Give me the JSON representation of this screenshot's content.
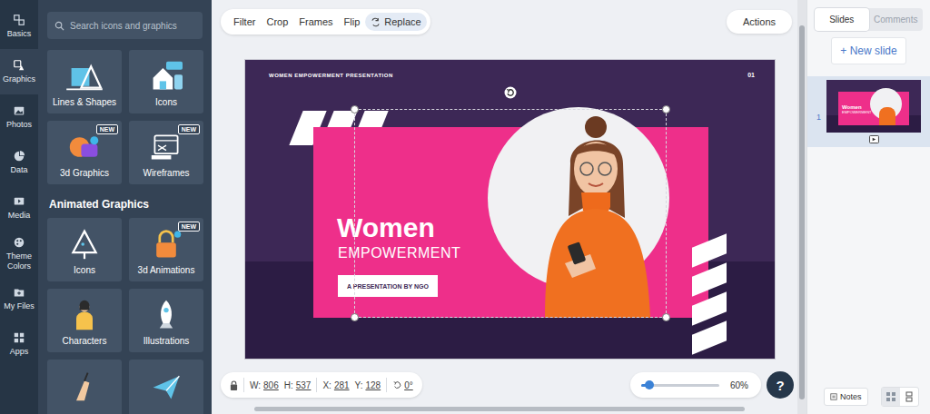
{
  "rail": [
    {
      "label": "Basics",
      "selected": false
    },
    {
      "label": "Graphics",
      "selected": true
    },
    {
      "label": "Photos",
      "selected": false
    },
    {
      "label": "Data",
      "selected": false
    },
    {
      "label": "Media",
      "selected": false
    },
    {
      "label": "Theme Colors",
      "selected": false
    },
    {
      "label": "My Files",
      "selected": false
    },
    {
      "label": "Apps",
      "selected": false
    }
  ],
  "search": {
    "placeholder": "Search icons and graphics"
  },
  "graphics": [
    {
      "label": "Lines & Shapes"
    },
    {
      "label": "Icons"
    },
    {
      "label": "3d Graphics",
      "badge": "NEW"
    },
    {
      "label": "Wireframes",
      "badge": "NEW"
    }
  ],
  "animated": {
    "heading": "Animated Graphics",
    "items": [
      {
        "label": "Icons"
      },
      {
        "label": "3d Animations",
        "badge": "NEW"
      },
      {
        "label": "Characters"
      },
      {
        "label": "Illustrations"
      },
      {
        "label": ""
      },
      {
        "label": ""
      }
    ]
  },
  "toolbar": {
    "items": [
      {
        "label": "Filter",
        "selected": false
      },
      {
        "label": "Crop",
        "selected": false
      },
      {
        "label": "Frames",
        "selected": false
      },
      {
        "label": "Flip",
        "selected": false
      },
      {
        "label": "Replace",
        "selected": true
      }
    ],
    "actions": "Actions"
  },
  "slide": {
    "header": "WOMEN EMPOWERMENT PRESENTATION",
    "number": "01",
    "title": "Women",
    "subtitle": "EMPOWERMENT",
    "tagline": "A PRESENTATION BY NGO",
    "selected": true
  },
  "status": {
    "locked": true,
    "fields": [
      {
        "label": "W:",
        "value": "806"
      },
      {
        "label": "H:",
        "value": "537"
      },
      {
        "label": "X:",
        "value": "281"
      },
      {
        "label": "Y:",
        "value": "128"
      }
    ],
    "rotation": "0°"
  },
  "zoom": {
    "level": 0.1,
    "reading": "60%"
  },
  "help": "?",
  "panel": {
    "tabs": [
      {
        "label": "Slides",
        "selected": true
      },
      {
        "label": "Comments",
        "selected": false
      }
    ],
    "new_slide": "+ New slide",
    "thumbnails": [
      {
        "number": "1",
        "selected": true
      }
    ],
    "notes": "Notes"
  }
}
